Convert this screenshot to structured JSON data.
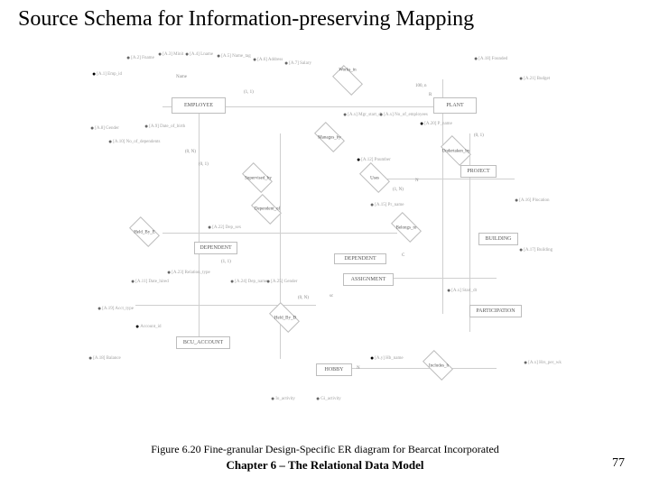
{
  "slide": {
    "title": "Source Schema for Information-preserving Mapping",
    "caption": "Figure 6.20 Fine-granular Design-Specific ER diagram for Bearcat Incorporated",
    "chapter": "Chapter 6 – The Relational Data Model",
    "page": "77"
  },
  "entities": {
    "employee": "EMPLOYEE",
    "plant": "PLANT",
    "project": "PROJECT",
    "building": "BUILDING",
    "participation": "PARTICIPATION",
    "dependent": "DEPENDENT",
    "assignment": "ASSIGNMENT",
    "bcu_account": "BCU_ACCOUNT",
    "hobby": "HOBBY"
  },
  "relationships": {
    "works_in": "Works_in",
    "manages_by": "Manages_by",
    "supervised_by": "Supervised_by",
    "dependent_of": "Dependent_of",
    "held_by_e": "Held_By_E",
    "held_by_d": "Held_By_D",
    "includes_h": "Includes_h",
    "belongs_to": "Belongs_to",
    "undertaken_by": "Undertaken_by",
    "uses": "Uses"
  },
  "attributes": {
    "emp_id": "[A.1] Emp_id",
    "fname": "[A.2] Fname",
    "minit": "[A.3] Minit",
    "lname": "[A.4] Lname",
    "name_tag": "[A.5] Name_tag",
    "address": "[A.6] Address",
    "salary": "[A.7] Salary",
    "gender": "[A.8] Gender",
    "dob": "[A.9] Date_of_birth",
    "num_dep": "[A.10] No_of_dependents",
    "date_hired": "[A.11] Date_hired",
    "mgr_start": "[A.x] Mgr_start_dt",
    "no_emp": "[A.x] No_of_employees",
    "p_name": "[A.20] P_name",
    "founded": "[A.18] Founded",
    "budget": "[A.21] Budget",
    "pnumber": "[A.12] Pnumber",
    "pr_name": "[A.15] Pr_name",
    "plocation": "[A.16] Plocation",
    "building_b": "[A.17] Building",
    "bstart": "[A.x] Start_dt",
    "hrs_wk": "[A.x] Hrs_per_wk",
    "hb_name": "[A.y] Hb_name",
    "io_activity": "Io_activity",
    "gi_activity": "Gi_activity",
    "dep_sex": "[A.22] Dep_sex",
    "relation": "[A.23] Relation_type",
    "dep_name": "[A.24] Dep_name",
    "gender2": "[A.25] Gender",
    "acct_id": "Account_id",
    "acct_type": "[A.19] Acct_type",
    "balance": "[A.18] Balance"
  },
  "cardinality": {
    "one_one": "(1, 1)",
    "one_n": "(1, N)",
    "zero_one": "(0, 1)",
    "zero_n": "(0, N)",
    "hundred_n": "100, n",
    "n": "N",
    "c": "C",
    "sc": "sc"
  }
}
